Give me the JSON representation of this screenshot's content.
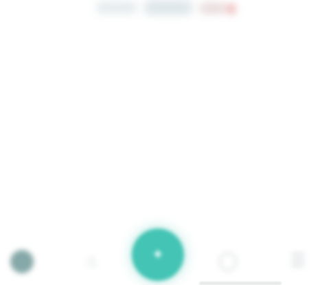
{
  "header": {
    "headline": "",
    "subline": ""
  },
  "colors": {
    "accent": "#43c4b4",
    "avatar": "#86a8a8",
    "muted_icon": "#c9cfd3",
    "headline_text": "#9aa3a8"
  },
  "bottom_nav": {
    "items": [
      {
        "icon": "avatar-icon",
        "glyph": ""
      },
      {
        "icon": "nav-icon",
        "glyph": "⌂"
      },
      {
        "icon": "center-action-icon",
        "glyph": "✦"
      },
      {
        "icon": "nav-icon",
        "glyph": "◯"
      },
      {
        "icon": "nav-icon",
        "glyph": "☰"
      }
    ]
  }
}
